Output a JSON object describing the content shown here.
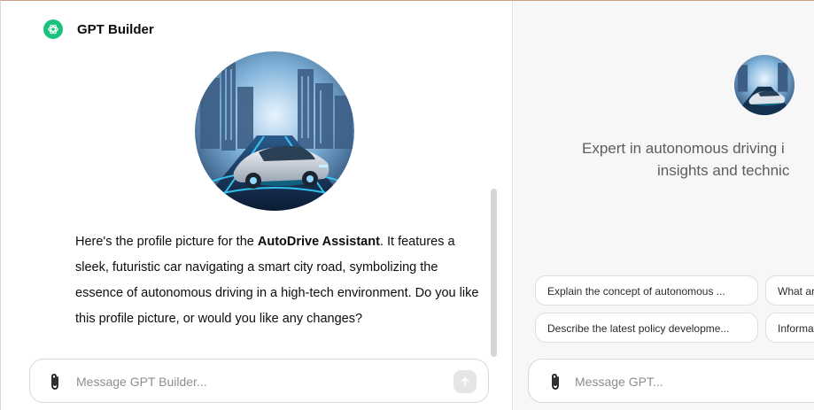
{
  "builder": {
    "title": "GPT Builder",
    "message_intro": "Here's the profile picture for the ",
    "gpt_name": "AutoDrive Assistant",
    "message_rest": ". It features a sleek, futuristic car navigating a smart city road, symbolizing the essence of autonomous driving in a high-tech environment. Do you like this profile picture, or would you like any changes?",
    "composer_placeholder": "Message GPT Builder..."
  },
  "preview": {
    "description_line1": "Expert in autonomous driving i",
    "description_line2": "insights and technic",
    "starters": [
      "Explain the concept of autonomous ...",
      "What ar",
      "Describe the latest policy developme...",
      "Informa"
    ],
    "composer_placeholder": "Message GPT..."
  },
  "icons": {
    "logo": "openai-logo-icon",
    "attach": "paperclip-icon",
    "send": "arrow-up-icon"
  },
  "colors": {
    "logo_bg": "#19c37d",
    "preview_bg": "#f7f7f8",
    "send_disabled": "#e5e5e5"
  }
}
